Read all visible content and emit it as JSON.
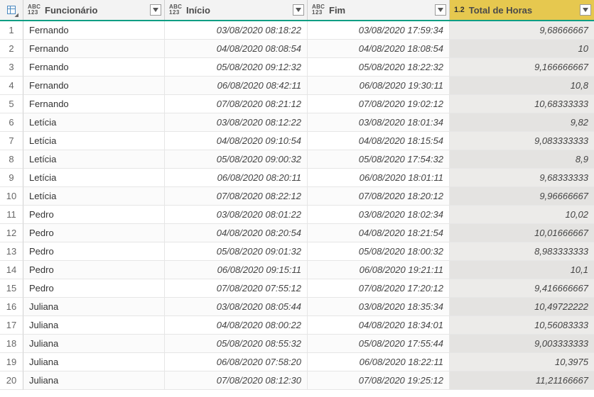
{
  "columns": {
    "funcionario": {
      "label": "Funcionário",
      "typeIcon": "abc123"
    },
    "inicio": {
      "label": "Início",
      "typeIcon": "abc123"
    },
    "fim": {
      "label": "Fim",
      "typeIcon": "abc123"
    },
    "total": {
      "label": "Total de Horas",
      "typeIcon": "1.2"
    }
  },
  "rows": [
    {
      "n": "1",
      "funcionario": "Fernando",
      "inicio": "03/08/2020 08:18:22",
      "fim": "03/08/2020 17:59:34",
      "total": "9,68666667"
    },
    {
      "n": "2",
      "funcionario": "Fernando",
      "inicio": "04/08/2020 08:08:54",
      "fim": "04/08/2020 18:08:54",
      "total": "10"
    },
    {
      "n": "3",
      "funcionario": "Fernando",
      "inicio": "05/08/2020 09:12:32",
      "fim": "05/08/2020 18:22:32",
      "total": "9,166666667"
    },
    {
      "n": "4",
      "funcionario": "Fernando",
      "inicio": "06/08/2020 08:42:11",
      "fim": "06/08/2020 19:30:11",
      "total": "10,8"
    },
    {
      "n": "5",
      "funcionario": "Fernando",
      "inicio": "07/08/2020 08:21:12",
      "fim": "07/08/2020 19:02:12",
      "total": "10,68333333"
    },
    {
      "n": "6",
      "funcionario": "Letícia",
      "inicio": "03/08/2020 08:12:22",
      "fim": "03/08/2020 18:01:34",
      "total": "9,82"
    },
    {
      "n": "7",
      "funcionario": "Letícia",
      "inicio": "04/08/2020 09:10:54",
      "fim": "04/08/2020 18:15:54",
      "total": "9,083333333"
    },
    {
      "n": "8",
      "funcionario": "Letícia",
      "inicio": "05/08/2020 09:00:32",
      "fim": "05/08/2020 17:54:32",
      "total": "8,9"
    },
    {
      "n": "9",
      "funcionario": "Letícia",
      "inicio": "06/08/2020 08:20:11",
      "fim": "06/08/2020 18:01:11",
      "total": "9,68333333"
    },
    {
      "n": "10",
      "funcionario": "Letícia",
      "inicio": "07/08/2020 08:22:12",
      "fim": "07/08/2020 18:20:12",
      "total": "9,96666667"
    },
    {
      "n": "11",
      "funcionario": "Pedro",
      "inicio": "03/08/2020 08:01:22",
      "fim": "03/08/2020 18:02:34",
      "total": "10,02"
    },
    {
      "n": "12",
      "funcionario": "Pedro",
      "inicio": "04/08/2020 08:20:54",
      "fim": "04/08/2020 18:21:54",
      "total": "10,01666667"
    },
    {
      "n": "13",
      "funcionario": "Pedro",
      "inicio": "05/08/2020 09:01:32",
      "fim": "05/08/2020 18:00:32",
      "total": "8,983333333"
    },
    {
      "n": "14",
      "funcionario": "Pedro",
      "inicio": "06/08/2020 09:15:11",
      "fim": "06/08/2020 19:21:11",
      "total": "10,1"
    },
    {
      "n": "15",
      "funcionario": "Pedro",
      "inicio": "07/08/2020 07:55:12",
      "fim": "07/08/2020 17:20:12",
      "total": "9,416666667"
    },
    {
      "n": "16",
      "funcionario": "Juliana",
      "inicio": "03/08/2020 08:05:44",
      "fim": "03/08/2020 18:35:34",
      "total": "10,49722222"
    },
    {
      "n": "17",
      "funcionario": "Juliana",
      "inicio": "04/08/2020 08:00:22",
      "fim": "04/08/2020 18:34:01",
      "total": "10,56083333"
    },
    {
      "n": "18",
      "funcionario": "Juliana",
      "inicio": "05/08/2020 08:55:32",
      "fim": "05/08/2020 17:55:44",
      "total": "9,003333333"
    },
    {
      "n": "19",
      "funcionario": "Juliana",
      "inicio": "06/08/2020 07:58:20",
      "fim": "06/08/2020 18:22:11",
      "total": "10,3975"
    },
    {
      "n": "20",
      "funcionario": "Juliana",
      "inicio": "07/08/2020 08:12:30",
      "fim": "07/08/2020 19:25:12",
      "total": "11,21166667"
    }
  ]
}
